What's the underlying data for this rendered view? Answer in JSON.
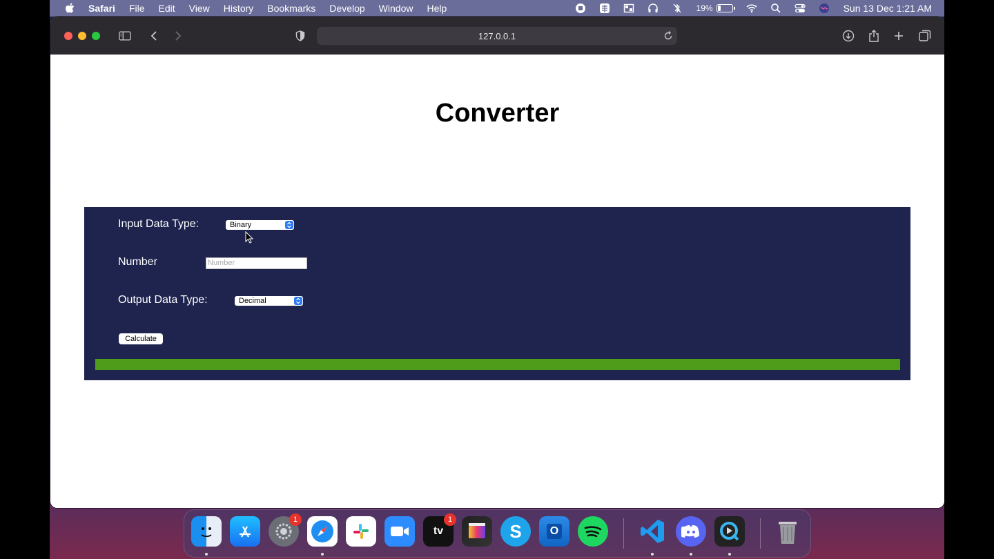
{
  "menubar": {
    "app_name": "Safari",
    "menus": [
      "File",
      "Edit",
      "View",
      "History",
      "Bookmarks",
      "Develop",
      "Window",
      "Help"
    ],
    "battery_percent": "19%",
    "battery_level": 0.19,
    "clock": "Sun 13 Dec  1:21 AM"
  },
  "browser": {
    "url": "127.0.0.1"
  },
  "page": {
    "title": "Converter",
    "input_type_label": "Input Data Type:",
    "input_type_value": "Binary",
    "number_label": "Number",
    "number_placeholder": "Number",
    "number_value": "",
    "output_type_label": "Output Data Type:",
    "output_type_value": "Decimal",
    "calculate_label": "Calculate",
    "result_bar_color": "#4f9c1a"
  },
  "dock": {
    "apps": [
      {
        "name": "Finder",
        "icon": "finder-icon",
        "badge": "",
        "running": true
      },
      {
        "name": "App Store",
        "icon": "app-store-icon",
        "badge": "",
        "running": false
      },
      {
        "name": "System Preferences",
        "icon": "system-preferences-icon",
        "badge": "1",
        "running": false
      },
      {
        "name": "Safari",
        "icon": "safari-icon",
        "badge": "",
        "running": true
      },
      {
        "name": "Slack",
        "icon": "slack-icon",
        "badge": "",
        "running": false
      },
      {
        "name": "Zoom",
        "icon": "zoom-icon",
        "badge": "",
        "running": false
      },
      {
        "name": "TV",
        "icon": "apple-tv-icon",
        "badge": "1",
        "running": false
      },
      {
        "name": "Final Cut Pro",
        "icon": "final-cut-pro-icon",
        "badge": "",
        "running": false
      },
      {
        "name": "Skype",
        "icon": "skype-icon",
        "badge": "",
        "running": false
      },
      {
        "name": "Outlook",
        "icon": "outlook-icon",
        "badge": "",
        "running": false
      },
      {
        "name": "Spotify",
        "icon": "spotify-icon",
        "badge": "",
        "running": false
      },
      {
        "name": "Visual Studio Code",
        "icon": "vscode-icon",
        "badge": "",
        "running": true
      },
      {
        "name": "Discord",
        "icon": "discord-icon",
        "badge": "",
        "running": true
      },
      {
        "name": "QuickTime Player",
        "icon": "quicktime-icon",
        "badge": "",
        "running": true
      },
      {
        "name": "Trash",
        "icon": "trash-icon",
        "badge": "",
        "running": false
      }
    ]
  }
}
